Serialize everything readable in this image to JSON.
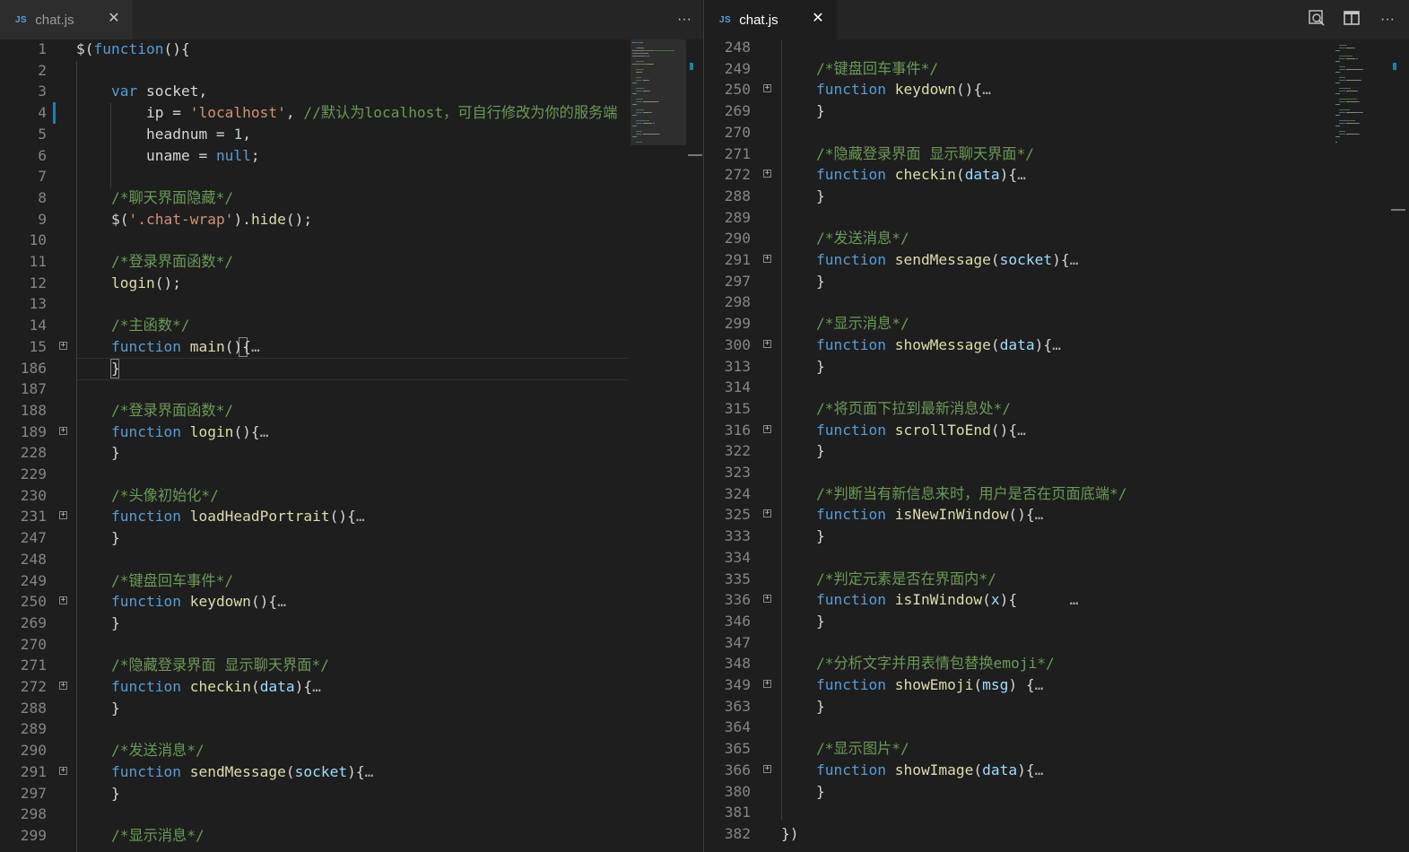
{
  "colors": {
    "keyword": "#569cd6",
    "function": "#dcdcaa",
    "string": "#ce9178",
    "comment": "#6a9955",
    "number": "#b5cea8",
    "param": "#9cdcfe",
    "plain": "#d4d4d4",
    "line_number": "#858585"
  },
  "left_pane": {
    "tab": {
      "file_icon": "JS",
      "title": "chat.js",
      "close": "✕",
      "active": false
    },
    "more_actions": "···",
    "lines": [
      {
        "n": "1",
        "fold": false,
        "tokens": [
          [
            "plain",
            "$("
          ],
          [
            "keyword",
            "function"
          ],
          [
            "plain",
            "(){"
          ]
        ]
      },
      {
        "n": "2",
        "fold": false,
        "tokens": []
      },
      {
        "n": "3",
        "fold": false,
        "tokens": [
          [
            "plain",
            "    "
          ],
          [
            "keyword",
            "var"
          ],
          [
            "plain",
            " socket,"
          ]
        ]
      },
      {
        "n": "4",
        "fold": false,
        "tokens": [
          [
            "plain",
            "        ip = "
          ],
          [
            "string",
            "'localhost'"
          ],
          [
            "plain",
            ", "
          ],
          [
            "comment",
            "//默认为localhost，可自行修改为你的服务端"
          ]
        ]
      },
      {
        "n": "5",
        "fold": false,
        "tokens": [
          [
            "plain",
            "        headnum = "
          ],
          [
            "number",
            "1"
          ],
          [
            "plain",
            ","
          ]
        ]
      },
      {
        "n": "6",
        "fold": false,
        "tokens": [
          [
            "plain",
            "        uname = "
          ],
          [
            "keyword",
            "null"
          ],
          [
            "plain",
            ";"
          ]
        ]
      },
      {
        "n": "7",
        "fold": false,
        "tokens": []
      },
      {
        "n": "8",
        "fold": false,
        "tokens": [
          [
            "plain",
            "    "
          ],
          [
            "comment",
            "/*聊天界面隐藏*/"
          ]
        ]
      },
      {
        "n": "9",
        "fold": false,
        "tokens": [
          [
            "plain",
            "    $("
          ],
          [
            "string",
            "'.chat-wrap'"
          ],
          [
            "plain",
            ")."
          ],
          [
            "fn",
            "hide"
          ],
          [
            "plain",
            "();"
          ]
        ]
      },
      {
        "n": "10",
        "fold": false,
        "tokens": []
      },
      {
        "n": "11",
        "fold": false,
        "tokens": [
          [
            "plain",
            "    "
          ],
          [
            "comment",
            "/*登录界面函数*/"
          ]
        ]
      },
      {
        "n": "12",
        "fold": false,
        "tokens": [
          [
            "plain",
            "    "
          ],
          [
            "fn",
            "login"
          ],
          [
            "plain",
            "();"
          ]
        ]
      },
      {
        "n": "13",
        "fold": false,
        "tokens": []
      },
      {
        "n": "14",
        "fold": false,
        "tokens": [
          [
            "plain",
            "    "
          ],
          [
            "comment",
            "/*主函数*/"
          ]
        ]
      },
      {
        "n": "15",
        "fold": true,
        "tokens": [
          [
            "plain",
            "    "
          ],
          [
            "keyword",
            "function"
          ],
          [
            "plain",
            " "
          ],
          [
            "fn",
            "main"
          ],
          [
            "plain",
            "(){"
          ],
          [
            "ellipsis",
            "…"
          ]
        ]
      },
      {
        "n": "186",
        "fold": false,
        "tokens": [
          [
            "plain",
            "    }"
          ]
        ]
      },
      {
        "n": "187",
        "fold": false,
        "tokens": []
      },
      {
        "n": "188",
        "fold": false,
        "tokens": [
          [
            "plain",
            "    "
          ],
          [
            "comment",
            "/*登录界面函数*/"
          ]
        ]
      },
      {
        "n": "189",
        "fold": true,
        "tokens": [
          [
            "plain",
            "    "
          ],
          [
            "keyword",
            "function"
          ],
          [
            "plain",
            " "
          ],
          [
            "fn",
            "login"
          ],
          [
            "plain",
            "(){"
          ],
          [
            "ellipsis",
            "…"
          ]
        ]
      },
      {
        "n": "228",
        "fold": false,
        "tokens": [
          [
            "plain",
            "    }"
          ]
        ]
      },
      {
        "n": "229",
        "fold": false,
        "tokens": []
      },
      {
        "n": "230",
        "fold": false,
        "tokens": [
          [
            "plain",
            "    "
          ],
          [
            "comment",
            "/*头像初始化*/"
          ]
        ]
      },
      {
        "n": "231",
        "fold": true,
        "tokens": [
          [
            "plain",
            "    "
          ],
          [
            "keyword",
            "function"
          ],
          [
            "plain",
            " "
          ],
          [
            "fn",
            "loadHeadPortrait"
          ],
          [
            "plain",
            "(){"
          ],
          [
            "ellipsis",
            "…"
          ]
        ]
      },
      {
        "n": "247",
        "fold": false,
        "tokens": [
          [
            "plain",
            "    }"
          ]
        ]
      },
      {
        "n": "248",
        "fold": false,
        "tokens": []
      },
      {
        "n": "249",
        "fold": false,
        "tokens": [
          [
            "plain",
            "    "
          ],
          [
            "comment",
            "/*键盘回车事件*/"
          ]
        ]
      },
      {
        "n": "250",
        "fold": true,
        "tokens": [
          [
            "plain",
            "    "
          ],
          [
            "keyword",
            "function"
          ],
          [
            "plain",
            " "
          ],
          [
            "fn",
            "keydown"
          ],
          [
            "plain",
            "(){"
          ],
          [
            "ellipsis",
            "…"
          ]
        ]
      },
      {
        "n": "269",
        "fold": false,
        "tokens": [
          [
            "plain",
            "    }"
          ]
        ]
      },
      {
        "n": "270",
        "fold": false,
        "tokens": []
      },
      {
        "n": "271",
        "fold": false,
        "tokens": [
          [
            "plain",
            "    "
          ],
          [
            "comment",
            "/*隐藏登录界面 显示聊天界面*/"
          ]
        ]
      },
      {
        "n": "272",
        "fold": true,
        "tokens": [
          [
            "plain",
            "    "
          ],
          [
            "keyword",
            "function"
          ],
          [
            "plain",
            " "
          ],
          [
            "fn",
            "checkin"
          ],
          [
            "plain",
            "("
          ],
          [
            "param",
            "data"
          ],
          [
            "plain",
            "){"
          ],
          [
            "ellipsis",
            "…"
          ]
        ]
      },
      {
        "n": "288",
        "fold": false,
        "tokens": [
          [
            "plain",
            "    }"
          ]
        ]
      },
      {
        "n": "289",
        "fold": false,
        "tokens": []
      },
      {
        "n": "290",
        "fold": false,
        "tokens": [
          [
            "plain",
            "    "
          ],
          [
            "comment",
            "/*发送消息*/"
          ]
        ]
      },
      {
        "n": "291",
        "fold": true,
        "tokens": [
          [
            "plain",
            "    "
          ],
          [
            "keyword",
            "function"
          ],
          [
            "plain",
            " "
          ],
          [
            "fn",
            "sendMessage"
          ],
          [
            "plain",
            "("
          ],
          [
            "param",
            "socket"
          ],
          [
            "plain",
            "){"
          ],
          [
            "ellipsis",
            "…"
          ]
        ]
      },
      {
        "n": "297",
        "fold": false,
        "tokens": [
          [
            "plain",
            "    }"
          ]
        ]
      },
      {
        "n": "298",
        "fold": false,
        "tokens": []
      },
      {
        "n": "299",
        "fold": false,
        "tokens": [
          [
            "plain",
            "    "
          ],
          [
            "comment",
            "/*显示消息*/"
          ]
        ]
      }
    ]
  },
  "right_pane": {
    "tab": {
      "file_icon": "JS",
      "title": "chat.js",
      "close": "✕",
      "active": true
    },
    "actions": {
      "find_icon": "⌕",
      "split_icon": "◫",
      "more": "···"
    },
    "lines": [
      {
        "n": "248",
        "fold": false,
        "tokens": []
      },
      {
        "n": "249",
        "fold": false,
        "tokens": [
          [
            "plain",
            "    "
          ],
          [
            "comment",
            "/*键盘回车事件*/"
          ]
        ]
      },
      {
        "n": "250",
        "fold": true,
        "tokens": [
          [
            "plain",
            "    "
          ],
          [
            "keyword",
            "function"
          ],
          [
            "plain",
            " "
          ],
          [
            "fn",
            "keydown"
          ],
          [
            "plain",
            "(){"
          ],
          [
            "ellipsis",
            "…"
          ]
        ]
      },
      {
        "n": "269",
        "fold": false,
        "tokens": [
          [
            "plain",
            "    }"
          ]
        ]
      },
      {
        "n": "270",
        "fold": false,
        "tokens": []
      },
      {
        "n": "271",
        "fold": false,
        "tokens": [
          [
            "plain",
            "    "
          ],
          [
            "comment",
            "/*隐藏登录界面 显示聊天界面*/"
          ]
        ]
      },
      {
        "n": "272",
        "fold": true,
        "tokens": [
          [
            "plain",
            "    "
          ],
          [
            "keyword",
            "function"
          ],
          [
            "plain",
            " "
          ],
          [
            "fn",
            "checkin"
          ],
          [
            "plain",
            "("
          ],
          [
            "param",
            "data"
          ],
          [
            "plain",
            "){"
          ],
          [
            "ellipsis",
            "…"
          ]
        ]
      },
      {
        "n": "288",
        "fold": false,
        "tokens": [
          [
            "plain",
            "    }"
          ]
        ]
      },
      {
        "n": "289",
        "fold": false,
        "tokens": []
      },
      {
        "n": "290",
        "fold": false,
        "tokens": [
          [
            "plain",
            "    "
          ],
          [
            "comment",
            "/*发送消息*/"
          ]
        ]
      },
      {
        "n": "291",
        "fold": true,
        "tokens": [
          [
            "plain",
            "    "
          ],
          [
            "keyword",
            "function"
          ],
          [
            "plain",
            " "
          ],
          [
            "fn",
            "sendMessage"
          ],
          [
            "plain",
            "("
          ],
          [
            "param",
            "socket"
          ],
          [
            "plain",
            "){"
          ],
          [
            "ellipsis",
            "…"
          ]
        ]
      },
      {
        "n": "297",
        "fold": false,
        "tokens": [
          [
            "plain",
            "    }"
          ]
        ]
      },
      {
        "n": "298",
        "fold": false,
        "tokens": []
      },
      {
        "n": "299",
        "fold": false,
        "tokens": [
          [
            "plain",
            "    "
          ],
          [
            "comment",
            "/*显示消息*/"
          ]
        ]
      },
      {
        "n": "300",
        "fold": true,
        "tokens": [
          [
            "plain",
            "    "
          ],
          [
            "keyword",
            "function"
          ],
          [
            "plain",
            " "
          ],
          [
            "fn",
            "showMessage"
          ],
          [
            "plain",
            "("
          ],
          [
            "param",
            "data"
          ],
          [
            "plain",
            "){"
          ],
          [
            "ellipsis",
            "…"
          ]
        ]
      },
      {
        "n": "313",
        "fold": false,
        "tokens": [
          [
            "plain",
            "    }"
          ]
        ]
      },
      {
        "n": "314",
        "fold": false,
        "tokens": []
      },
      {
        "n": "315",
        "fold": false,
        "tokens": [
          [
            "plain",
            "    "
          ],
          [
            "comment",
            "/*将页面下拉到最新消息处*/"
          ]
        ]
      },
      {
        "n": "316",
        "fold": true,
        "tokens": [
          [
            "plain",
            "    "
          ],
          [
            "keyword",
            "function"
          ],
          [
            "plain",
            " "
          ],
          [
            "fn",
            "scrollToEnd"
          ],
          [
            "plain",
            "(){"
          ],
          [
            "ellipsis",
            "…"
          ]
        ]
      },
      {
        "n": "322",
        "fold": false,
        "tokens": [
          [
            "plain",
            "    }"
          ]
        ]
      },
      {
        "n": "323",
        "fold": false,
        "tokens": []
      },
      {
        "n": "324",
        "fold": false,
        "tokens": [
          [
            "plain",
            "    "
          ],
          [
            "comment",
            "/*判断当有新信息来时，用户是否在页面底端*/"
          ]
        ]
      },
      {
        "n": "325",
        "fold": true,
        "tokens": [
          [
            "plain",
            "    "
          ],
          [
            "keyword",
            "function"
          ],
          [
            "plain",
            " "
          ],
          [
            "fn",
            "isNewInWindow"
          ],
          [
            "plain",
            "(){"
          ],
          [
            "ellipsis",
            "…"
          ]
        ]
      },
      {
        "n": "333",
        "fold": false,
        "tokens": [
          [
            "plain",
            "    }"
          ]
        ]
      },
      {
        "n": "334",
        "fold": false,
        "tokens": []
      },
      {
        "n": "335",
        "fold": false,
        "tokens": [
          [
            "plain",
            "    "
          ],
          [
            "comment",
            "/*判定元素是否在界面内*/"
          ]
        ]
      },
      {
        "n": "336",
        "fold": true,
        "tokens": [
          [
            "plain",
            "    "
          ],
          [
            "keyword",
            "function"
          ],
          [
            "plain",
            " "
          ],
          [
            "fn",
            "isInWindow"
          ],
          [
            "plain",
            "("
          ],
          [
            "param",
            "x"
          ],
          [
            "plain",
            "){      "
          ],
          [
            "ellipsis",
            "…"
          ]
        ]
      },
      {
        "n": "346",
        "fold": false,
        "tokens": [
          [
            "plain",
            "    }"
          ]
        ]
      },
      {
        "n": "347",
        "fold": false,
        "tokens": []
      },
      {
        "n": "348",
        "fold": false,
        "tokens": [
          [
            "plain",
            "    "
          ],
          [
            "comment",
            "/*分析文字并用表情包替换emoji*/"
          ]
        ]
      },
      {
        "n": "349",
        "fold": true,
        "tokens": [
          [
            "plain",
            "    "
          ],
          [
            "keyword",
            "function"
          ],
          [
            "plain",
            " "
          ],
          [
            "fn",
            "showEmoji"
          ],
          [
            "plain",
            "("
          ],
          [
            "param",
            "msg"
          ],
          [
            "plain",
            ") {"
          ],
          [
            "ellipsis",
            "…"
          ]
        ]
      },
      {
        "n": "363",
        "fold": false,
        "tokens": [
          [
            "plain",
            "    }"
          ]
        ]
      },
      {
        "n": "364",
        "fold": false,
        "tokens": []
      },
      {
        "n": "365",
        "fold": false,
        "tokens": [
          [
            "plain",
            "    "
          ],
          [
            "comment",
            "/*显示图片*/"
          ]
        ]
      },
      {
        "n": "366",
        "fold": true,
        "tokens": [
          [
            "plain",
            "    "
          ],
          [
            "keyword",
            "function"
          ],
          [
            "plain",
            " "
          ],
          [
            "fn",
            "showImage"
          ],
          [
            "plain",
            "("
          ],
          [
            "param",
            "data"
          ],
          [
            "plain",
            "){"
          ],
          [
            "ellipsis",
            "…"
          ]
        ]
      },
      {
        "n": "380",
        "fold": false,
        "tokens": [
          [
            "plain",
            "    }"
          ]
        ]
      },
      {
        "n": "381",
        "fold": false,
        "tokens": []
      },
      {
        "n": "382",
        "fold": false,
        "tokens": [
          [
            "plain",
            "})"
          ]
        ]
      }
    ]
  }
}
